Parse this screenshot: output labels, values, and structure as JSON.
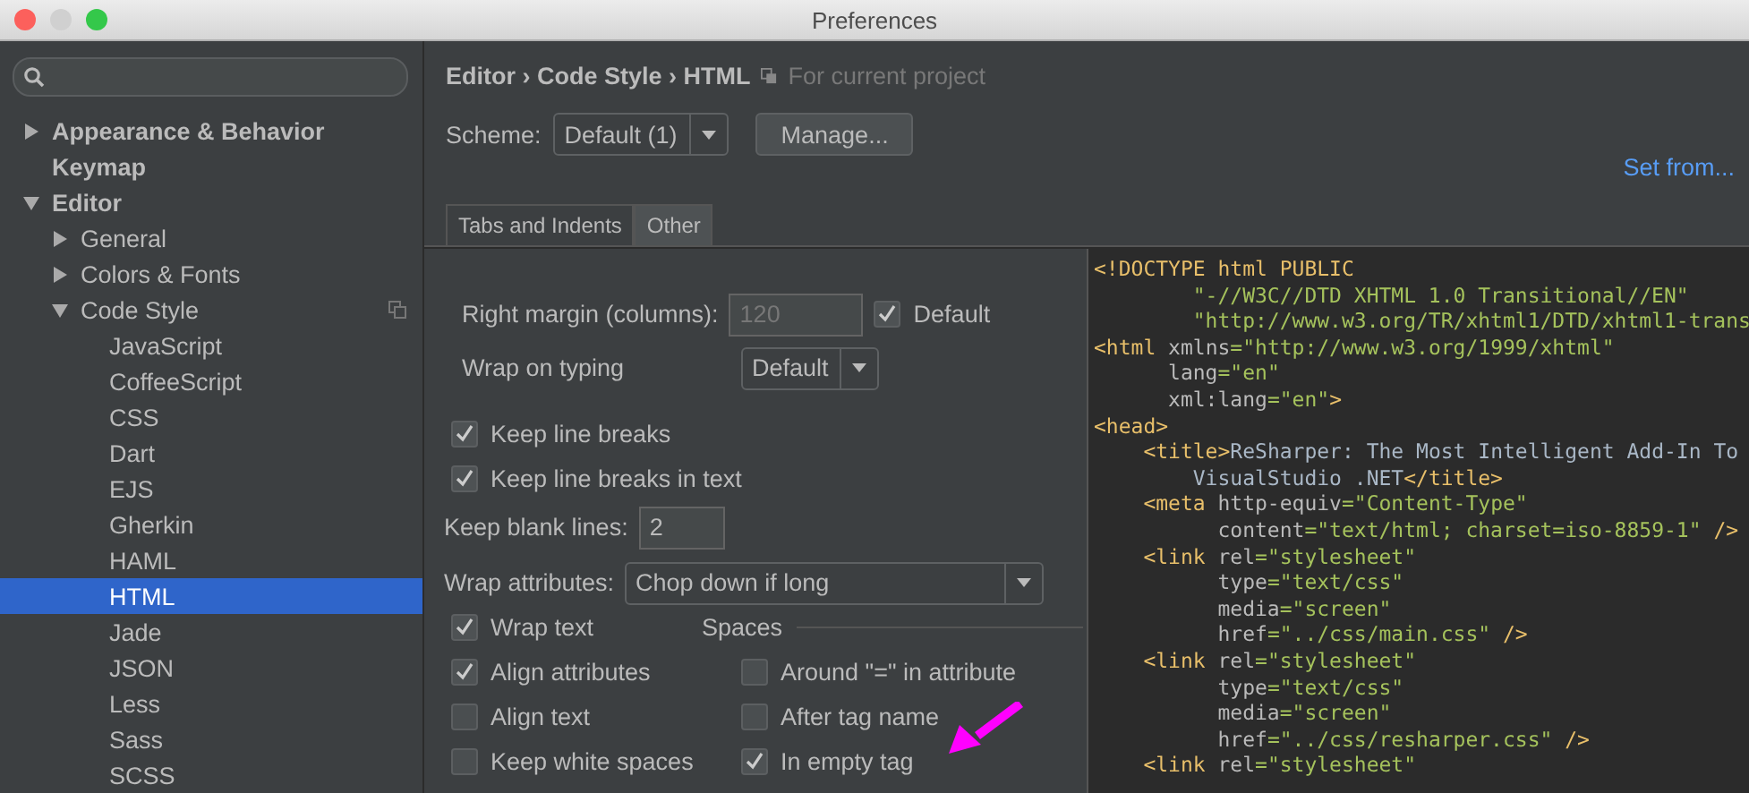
{
  "window": {
    "title": "Preferences"
  },
  "sidebar": {
    "tree": [
      {
        "label": "Appearance & Behavior",
        "bold": true,
        "expanded": false,
        "selected": false
      },
      {
        "label": "Keymap",
        "bold": true,
        "selected": false
      },
      {
        "label": "Editor",
        "bold": true,
        "expanded": true,
        "selected": false,
        "children": [
          {
            "label": "General",
            "expanded": false,
            "selected": false
          },
          {
            "label": "Colors & Fonts",
            "expanded": false,
            "selected": false
          },
          {
            "label": "Code Style",
            "expanded": true,
            "selected": false,
            "project_specific": true,
            "children": [
              {
                "label": "JavaScript",
                "selected": false
              },
              {
                "label": "CoffeeScript",
                "selected": false
              },
              {
                "label": "CSS",
                "selected": false
              },
              {
                "label": "Dart",
                "selected": false
              },
              {
                "label": "EJS",
                "selected": false
              },
              {
                "label": "Gherkin",
                "selected": false
              },
              {
                "label": "HAML",
                "selected": false
              },
              {
                "label": "HTML",
                "selected": true
              },
              {
                "label": "Jade",
                "selected": false
              },
              {
                "label": "JSON",
                "selected": false
              },
              {
                "label": "Less",
                "selected": false
              },
              {
                "label": "Sass",
                "selected": false
              },
              {
                "label": "SCSS",
                "selected": false
              }
            ]
          }
        ]
      }
    ]
  },
  "header": {
    "breadcrumb": "Editor › Code Style › HTML",
    "scope": "For current project"
  },
  "scheme": {
    "label": "Scheme:",
    "value": "Default (1)",
    "manage": "Manage...",
    "set_from": "Set from..."
  },
  "tabs": [
    {
      "label": "Tabs and Indents",
      "selected": false
    },
    {
      "label": "Other",
      "selected": true
    }
  ],
  "form": {
    "right_margin": {
      "label": "Right margin (columns):",
      "value": "120",
      "disabled": true,
      "default_label": "Default",
      "default_checked": true
    },
    "wrap_on_typing": {
      "label": "Wrap on typing",
      "value": "Default"
    },
    "checks_top": [
      {
        "label": "Keep line breaks",
        "checked": true
      },
      {
        "label": "Keep line breaks in text",
        "checked": true
      }
    ],
    "blank_lines": {
      "label": "Keep blank lines:",
      "value": "2"
    },
    "wrap_attributes": {
      "label": "Wrap attributes:",
      "value": "Chop down if long"
    },
    "checks_left": [
      {
        "label": "Wrap text",
        "checked": true
      },
      {
        "label": "Align attributes",
        "checked": true
      },
      {
        "label": "Align text",
        "checked": false
      },
      {
        "label": "Keep white spaces",
        "checked": false
      }
    ],
    "spaces": {
      "title": "Spaces",
      "checks": [
        {
          "label": "Around \"=\" in attribute",
          "checked": false
        },
        {
          "label": "After tag name",
          "checked": false
        },
        {
          "label": "In empty tag",
          "checked": true
        }
      ]
    }
  },
  "preview": {
    "lines": [
      [
        {
          "kind": "tag",
          "text": "<!DOCTYPE html PUBLIC"
        }
      ],
      [
        {
          "kind": "value",
          "text": "        \"-//W3C//DTD XHTML 1.0 Transitional//EN\""
        }
      ],
      [
        {
          "kind": "value",
          "text": "        \"http://www.w3.org/TR/xhtml1/DTD/xhtml1-trans"
        }
      ],
      [
        {
          "kind": "tag",
          "text": "<html"
        },
        {
          "kind": "attr",
          "text": " xmlns"
        },
        {
          "kind": "value",
          "text": "=\"http://www.w3.org/1999/xhtml\""
        }
      ],
      [
        {
          "kind": "attr",
          "text": "      lang"
        },
        {
          "kind": "value",
          "text": "=\"en\""
        }
      ],
      [
        {
          "kind": "attr",
          "text": "      xml:lang"
        },
        {
          "kind": "value",
          "text": "=\"en\""
        },
        {
          "kind": "tag",
          "text": ">"
        }
      ],
      [
        {
          "kind": "tag",
          "text": "<head>"
        }
      ],
      [
        {
          "kind": "tag",
          "text": "    <title>"
        },
        {
          "kind": "plain",
          "text": "ReSharper: The Most Intelligent Add-In To"
        }
      ],
      [
        {
          "kind": "plain",
          "text": "        VisualStudio .NET"
        },
        {
          "kind": "tag",
          "text": "</title>"
        }
      ],
      [
        {
          "kind": "tag",
          "text": "    <meta"
        },
        {
          "kind": "attr",
          "text": " http-equiv"
        },
        {
          "kind": "value",
          "text": "=\"Content-Type\""
        }
      ],
      [
        {
          "kind": "attr",
          "text": "          content"
        },
        {
          "kind": "value",
          "text": "=\"text/html; charset=iso-8859-1\""
        },
        {
          "kind": "tag",
          "text": " />"
        }
      ],
      [
        {
          "kind": "tag",
          "text": "    <link"
        },
        {
          "kind": "attr",
          "text": " rel"
        },
        {
          "kind": "value",
          "text": "=\"stylesheet\""
        }
      ],
      [
        {
          "kind": "attr",
          "text": "          type"
        },
        {
          "kind": "value",
          "text": "=\"text/css\""
        }
      ],
      [
        {
          "kind": "attr",
          "text": "          media"
        },
        {
          "kind": "value",
          "text": "=\"screen\""
        }
      ],
      [
        {
          "kind": "attr",
          "text": "          href"
        },
        {
          "kind": "value",
          "text": "=\"../css/main.css\""
        },
        {
          "kind": "tag",
          "text": " />"
        }
      ],
      [
        {
          "kind": "tag",
          "text": "    <link"
        },
        {
          "kind": "attr",
          "text": " rel"
        },
        {
          "kind": "value",
          "text": "=\"stylesheet\""
        }
      ],
      [
        {
          "kind": "attr",
          "text": "          type"
        },
        {
          "kind": "value",
          "text": "=\"text/css\""
        }
      ],
      [
        {
          "kind": "attr",
          "text": "          media"
        },
        {
          "kind": "value",
          "text": "=\"screen\""
        }
      ],
      [
        {
          "kind": "attr",
          "text": "          href"
        },
        {
          "kind": "value",
          "text": "=\"../css/resharper.css\""
        },
        {
          "kind": "tag",
          "text": " />"
        }
      ],
      [
        {
          "kind": "tag",
          "text": "    <link"
        },
        {
          "kind": "attr",
          "text": " rel"
        },
        {
          "kind": "value",
          "text": "=\"stylesheet\""
        }
      ]
    ]
  }
}
